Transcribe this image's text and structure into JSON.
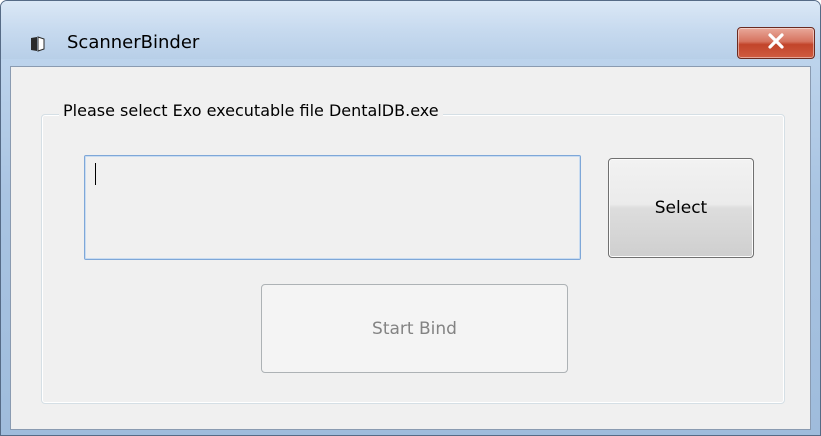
{
  "window": {
    "title": "ScannerBinder",
    "icon": "app-icon",
    "close_icon": "close-icon"
  },
  "group": {
    "label": "Please select Exo executable file DentalDB.exe"
  },
  "path_input": {
    "value": ""
  },
  "buttons": {
    "select_label": "Select",
    "start_bind_label": "Start Bind",
    "start_bind_enabled": false
  },
  "colors": {
    "close_button": "#c2442a",
    "input_border": "#7ea7d8",
    "disabled_text": "#838383"
  }
}
